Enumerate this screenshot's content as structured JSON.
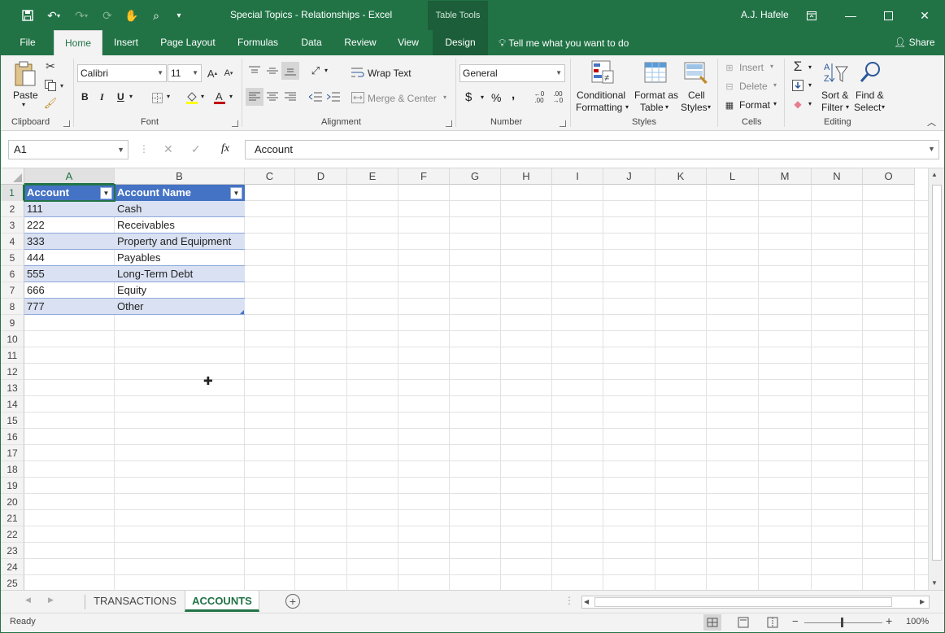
{
  "window": {
    "title": "Special Topics - Relationships  -  Excel",
    "context_tab": "Table Tools",
    "user": "A.J. Hafele",
    "accent": "#217346"
  },
  "tabs": [
    "File",
    "Home",
    "Insert",
    "Page Layout",
    "Formulas",
    "Data",
    "Review",
    "View",
    "Design"
  ],
  "tell_me": "Tell me what you want to do",
  "share": "Share",
  "ribbon": {
    "clipboard": {
      "paste": "Paste",
      "label": "Clipboard"
    },
    "font": {
      "name": "Calibri",
      "size": "11",
      "bold": "B",
      "italic": "I",
      "underline": "U",
      "label": "Font"
    },
    "alignment": {
      "wrap": "Wrap Text",
      "merge": "Merge & Center",
      "label": "Alignment"
    },
    "number": {
      "format": "General",
      "currency": "$",
      "percent": "%",
      "comma": ",",
      "label": "Number"
    },
    "styles": {
      "conditional_1": "Conditional",
      "conditional_2": "Formatting",
      "format_table_1": "Format as",
      "format_table_2": "Table",
      "cell_styles_1": "Cell",
      "cell_styles_2": "Styles",
      "label": "Styles"
    },
    "cells": {
      "insert": "Insert",
      "delete": "Delete",
      "format": "Format",
      "label": "Cells"
    },
    "editing": {
      "sort_1": "Sort &",
      "sort_2": "Filter",
      "find_1": "Find &",
      "find_2": "Select",
      "label": "Editing"
    }
  },
  "formula_bar": {
    "name_box": "A1",
    "fx": "fx",
    "content": "Account"
  },
  "columns": [
    "A",
    "B",
    "C",
    "D",
    "E",
    "F",
    "G",
    "H",
    "I",
    "J",
    "K",
    "L",
    "M",
    "N",
    "O"
  ],
  "rows": [
    "1",
    "2",
    "3",
    "4",
    "5",
    "6",
    "7",
    "8",
    "9",
    "10",
    "11",
    "12",
    "13",
    "14",
    "15",
    "16",
    "17",
    "18",
    "19",
    "20",
    "21",
    "22",
    "23",
    "24",
    "25"
  ],
  "table": {
    "headers": [
      "Account",
      "Account Name"
    ],
    "rows": [
      [
        "111",
        "Cash"
      ],
      [
        "222",
        "Receivables"
      ],
      [
        "333",
        "Property and Equipment"
      ],
      [
        "444",
        "Payables"
      ],
      [
        "555",
        "Long-Term Debt"
      ],
      [
        "666",
        "Equity"
      ],
      [
        "777",
        "Other"
      ]
    ],
    "header_color": "#4472c4",
    "band_color": "#d9e1f2"
  },
  "sheets": [
    "TRANSACTIONS",
    "ACCOUNTS"
  ],
  "active_sheet": "ACCOUNTS",
  "status": {
    "text": "Ready",
    "zoom": "100%"
  }
}
